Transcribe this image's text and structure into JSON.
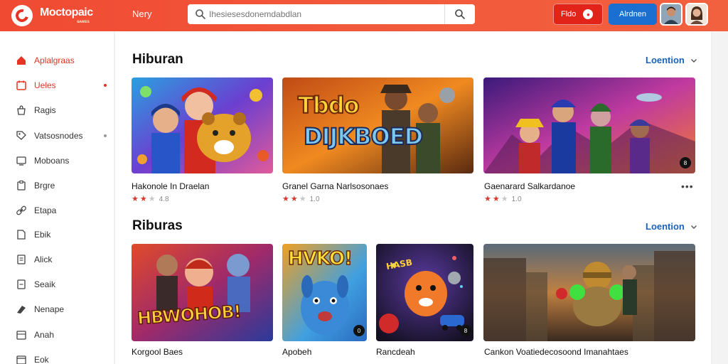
{
  "header": {
    "brand": "Moctopaic",
    "brand_sub": "ɢᴀᴍᴇs",
    "nav_link": "Nery",
    "search_placeholder": "Ihesiesesdonemdabdlan",
    "btn_red_label": "Fldo",
    "btn_blue_label": "Alrdnen"
  },
  "sidebar": {
    "items": [
      {
        "label": "Aplalgraas",
        "icon": "home-icon",
        "active": true
      },
      {
        "label": "Ueles",
        "icon": "tag-icon",
        "active": true,
        "dot": true
      },
      {
        "label": "Ragis",
        "icon": "bag-icon"
      },
      {
        "label": "Vatsosnodes",
        "icon": "tag-outline-icon",
        "dot": true
      },
      {
        "label": "Moboans",
        "icon": "monitor-icon"
      },
      {
        "label": "Brgre",
        "icon": "clipboard-icon"
      },
      {
        "label": "Etapa",
        "icon": "link-icon"
      },
      {
        "label": "Ebik",
        "icon": "document-icon"
      },
      {
        "label": "Alick",
        "icon": "note-icon"
      },
      {
        "label": "Seaik",
        "icon": "file-icon"
      },
      {
        "label": "Nenape",
        "icon": "arrow-icon"
      },
      {
        "label": "Anah",
        "icon": "archive-icon"
      },
      {
        "label": "Eok",
        "icon": "box-icon"
      }
    ]
  },
  "sections": [
    {
      "title": "Hiburan",
      "see_more": "Loention",
      "cards": [
        {
          "title": "Hakonole In Draelan",
          "rating": 2,
          "score": "4.8"
        },
        {
          "title": "Granel Garna Narlsosonaes",
          "rating": 2,
          "score": "1.0"
        },
        {
          "title": "Gaenarard Salkardanoe",
          "rating": 2,
          "score": "1.0"
        }
      ]
    },
    {
      "title": "Riburas",
      "see_more": "Loention",
      "cards": [
        {
          "title": "Korgool Baes"
        },
        {
          "title": "Apobeh"
        },
        {
          "title": "Rancdeah"
        },
        {
          "title": "Cankon Voatiedecosoond Imanahtaes"
        }
      ]
    }
  ],
  "images_text": {
    "banner_line1": "Tbdo",
    "banner_line2": "DIJKBOED",
    "banner_3_text": "HBWOHOB!",
    "banner_4_text": "HVKO!",
    "banner_5_text": "HASB"
  },
  "badges": {
    "card3": "8",
    "card5": "0",
    "card6": "8"
  },
  "colors": {
    "topbar": "#f04a33",
    "accent_red": "#e53424",
    "link_blue": "#1b63b8",
    "star_on": "#d33a2c"
  }
}
